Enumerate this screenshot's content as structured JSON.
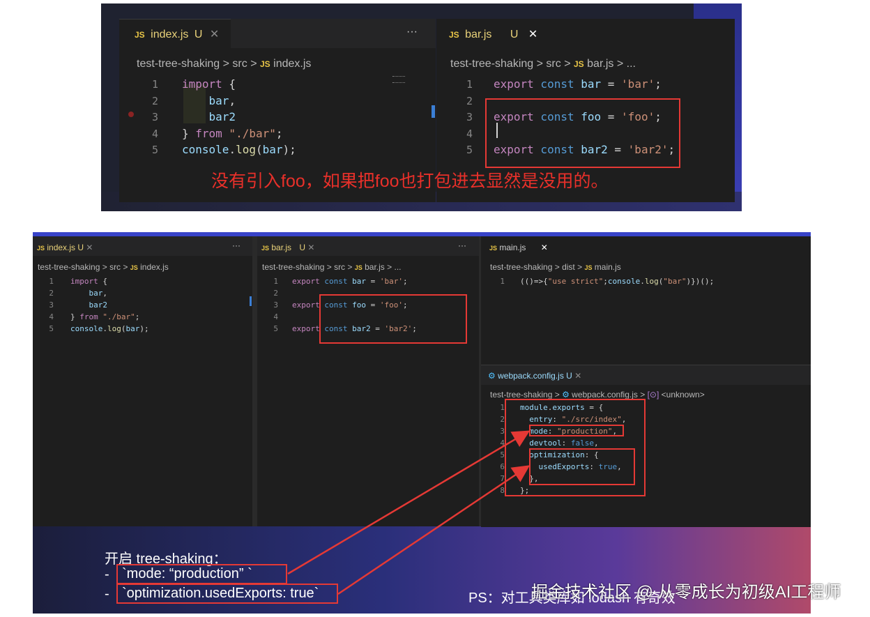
{
  "top": {
    "left": {
      "tab": {
        "icon": "JS",
        "name": "index.js",
        "status": "U"
      },
      "more": "···",
      "breadcrumb": {
        "project": "test-tree-shaking",
        "folder": "src",
        "file": "index.js"
      },
      "lines": [
        {
          "n": "1",
          "t": [
            [
              "import",
              "k"
            ],
            [
              " {",
              "p"
            ]
          ]
        },
        {
          "n": "2",
          "t": [
            [
              "    bar",
              "v"
            ],
            [
              ",",
              "p"
            ]
          ]
        },
        {
          "n": "3",
          "t": [
            [
              "    bar2",
              "v"
            ]
          ]
        },
        {
          "n": "4",
          "t": [
            [
              "} ",
              "p"
            ],
            [
              "from",
              "k"
            ],
            [
              " \"./bar\"",
              "s"
            ],
            [
              ";",
              "p"
            ]
          ]
        },
        {
          "n": "5",
          "t": [
            [
              "console",
              "v"
            ],
            [
              ".",
              "p"
            ],
            [
              "log",
              "f"
            ],
            [
              "(",
              "p"
            ],
            [
              "bar",
              "v"
            ],
            [
              ");",
              "p"
            ]
          ]
        }
      ]
    },
    "right": {
      "tab": {
        "icon": "JS",
        "name": "bar.js",
        "status": "U"
      },
      "breadcrumb": {
        "project": "test-tree-shaking",
        "folder": "src",
        "file": "bar.js",
        "tail": "..."
      },
      "lines": [
        {
          "n": "1",
          "t": [
            [
              "export",
              "k"
            ],
            [
              " const ",
              "kb"
            ],
            [
              "bar",
              "v"
            ],
            [
              " = ",
              "p"
            ],
            [
              "'bar'",
              "s"
            ],
            [
              ";",
              "p"
            ]
          ]
        },
        {
          "n": "2",
          "t": []
        },
        {
          "n": "3",
          "t": [
            [
              "export",
              "k"
            ],
            [
              " const ",
              "kb"
            ],
            [
              "foo",
              "v"
            ],
            [
              " = ",
              "p"
            ],
            [
              "'foo'",
              "s"
            ],
            [
              ";",
              "p"
            ]
          ]
        },
        {
          "n": "4",
          "t": []
        },
        {
          "n": "5",
          "t": [
            [
              "export",
              "k"
            ],
            [
              " const ",
              "kb"
            ],
            [
              "bar2",
              "v"
            ],
            [
              " = ",
              "p"
            ],
            [
              "'bar2'",
              "s"
            ],
            [
              ";",
              "p"
            ]
          ]
        }
      ]
    },
    "caption": "没有引入foo，如果把foo也打包进去显然是没用的。"
  },
  "bottom": {
    "p1": {
      "tab": {
        "icon": "JS",
        "name": "index.js",
        "status": "U"
      },
      "more": "···",
      "breadcrumb": {
        "project": "test-tree-shaking",
        "folder": "src",
        "file": "index.js"
      }
    },
    "p2": {
      "tab": {
        "icon": "JS",
        "name": "bar.js",
        "status": "U"
      },
      "more": "···",
      "breadcrumb": {
        "project": "test-tree-shaking",
        "folder": "src",
        "file": "bar.js",
        "tail": "..."
      }
    },
    "p3": {
      "tab": {
        "icon": "JS",
        "name": "main.js"
      },
      "breadcrumb": {
        "project": "test-tree-shaking",
        "folder": "dist",
        "file": "main.js"
      },
      "lines": [
        {
          "n": "1",
          "t": [
            [
              "(()=>{",
              "p"
            ],
            [
              "\"use strict\"",
              "s"
            ],
            [
              ";",
              "p"
            ],
            [
              "console",
              "v"
            ],
            [
              ".",
              "p"
            ],
            [
              "log",
              "f"
            ],
            [
              "(",
              "p"
            ],
            [
              "\"bar\"",
              "s"
            ],
            [
              ")})();",
              "p"
            ]
          ]
        }
      ]
    },
    "p4": {
      "tab": {
        "icon": "⚙",
        "name": "webpack.config.js",
        "status": "U"
      },
      "breadcrumb": {
        "project": "test-tree-shaking",
        "file": "webpack.config.js",
        "symbol": "<unknown>"
      },
      "lines": [
        {
          "n": "1",
          "t": [
            [
              "module",
              "v"
            ],
            [
              ".",
              "p"
            ],
            [
              "exports",
              "v"
            ],
            [
              " = {",
              "p"
            ]
          ]
        },
        {
          "n": "2",
          "t": [
            [
              "  entry",
              "v"
            ],
            [
              ": ",
              "p"
            ],
            [
              "\"./src/index\"",
              "s"
            ],
            [
              ",",
              "p"
            ]
          ]
        },
        {
          "n": "3",
          "t": [
            [
              "  mode",
              "v"
            ],
            [
              ": ",
              "p"
            ],
            [
              "\"production\"",
              "s"
            ],
            [
              ",",
              "p"
            ]
          ]
        },
        {
          "n": "4",
          "t": [
            [
              "  devtool",
              "v"
            ],
            [
              ": ",
              "p"
            ],
            [
              "false",
              "lit"
            ],
            [
              ",",
              "p"
            ]
          ]
        },
        {
          "n": "5",
          "t": [
            [
              "  optimization",
              "v"
            ],
            [
              ": {",
              "p"
            ]
          ]
        },
        {
          "n": "6",
          "t": [
            [
              "    usedExports",
              "v"
            ],
            [
              ": ",
              "p"
            ],
            [
              "true",
              "lit"
            ],
            [
              ",",
              "p"
            ]
          ]
        },
        {
          "n": "7",
          "t": [
            [
              "  },",
              "p"
            ]
          ]
        },
        {
          "n": "8",
          "t": [
            [
              "};",
              "p"
            ]
          ]
        }
      ]
    },
    "notes": {
      "heading": "开启 tree-shaking：",
      "item1_dash": "-",
      "item1": "`mode:  “production” `",
      "item2_dash": "-",
      "item2": "`optimization.usedExports: true`",
      "ps": "PS：对工具类库如 lodash 有奇效"
    }
  },
  "watermark": "掘金技术社区 @ 从零成长为初级AI工程师"
}
